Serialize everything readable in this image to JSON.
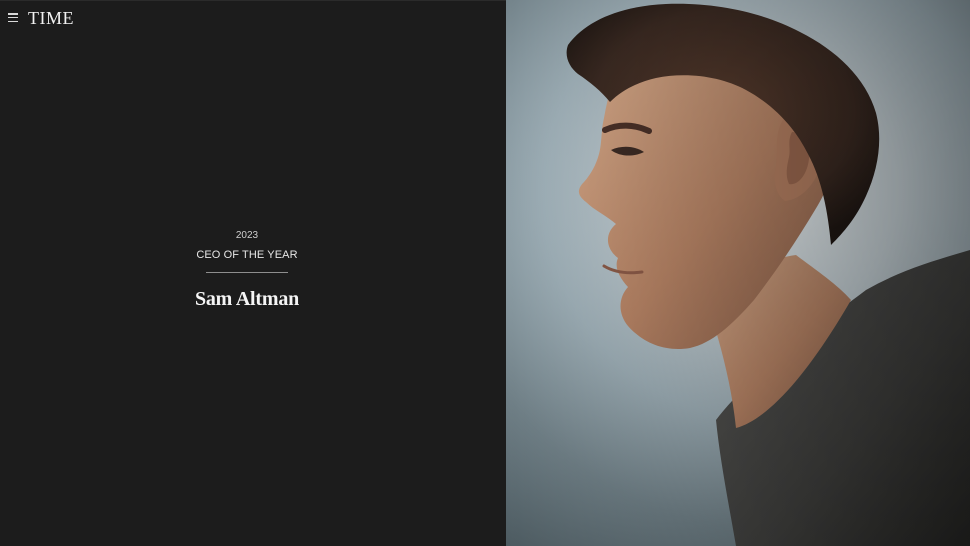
{
  "header": {
    "logo_text": "TIME",
    "menu_icon": "hamburger-menu-icon"
  },
  "feature": {
    "year": "2023",
    "category": "CEO OF THE YEAR",
    "name": "Sam Altman"
  },
  "portrait": {
    "alt": "portrait photo of Sam Altman in profile",
    "background_color": "#c8d3d8",
    "sweater_color": "#4a4a4a",
    "skin_color": "#c79672",
    "hair_color": "#3b2a22"
  },
  "colors": {
    "left_panel": "#1c1c1c",
    "text_primary": "#f5f5f5",
    "text_secondary": "#cfcfcf",
    "divider": "#8e8e8e"
  }
}
